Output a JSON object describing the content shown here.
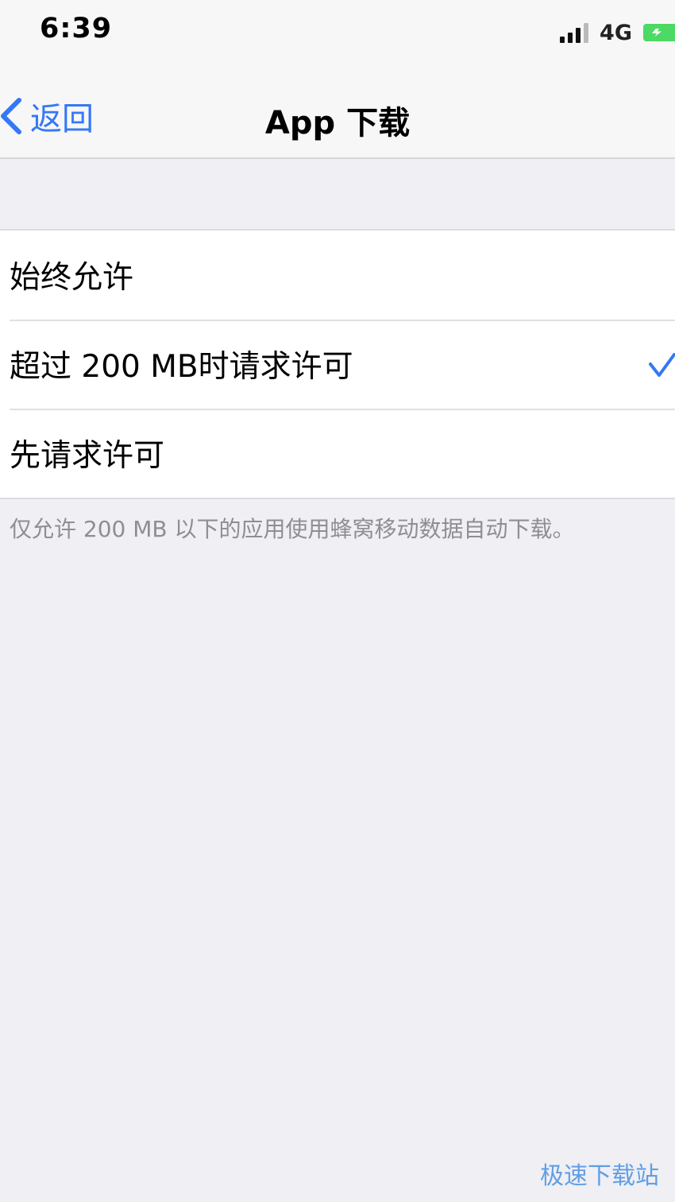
{
  "status_bar": {
    "time": "6:39",
    "network": "4G",
    "icons": [
      "signal-icon",
      "battery-charging-icon"
    ]
  },
  "nav": {
    "back_label": "返回",
    "title": "App 下载",
    "back_icon": "chevron-left-icon"
  },
  "options": [
    {
      "label": "始终允许",
      "selected": false
    },
    {
      "label": "超过 200 MB时请求许可",
      "selected": true
    },
    {
      "label": "先请求许可",
      "selected": false
    }
  ],
  "footer_note": "仅允许 200 MB 以下的应用使用蜂窝移动数据自动下载。",
  "watermark": "极速下载站",
  "colors": {
    "accent": "#3478f6",
    "background": "#efeff4",
    "battery": "#4cd964",
    "secondary_text": "#8e8e93"
  }
}
